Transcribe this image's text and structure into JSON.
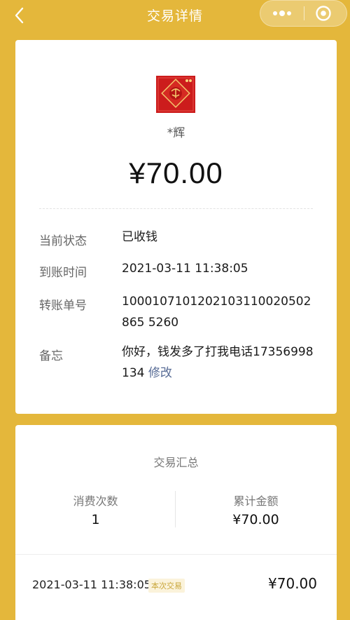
{
  "header": {
    "title": "交易详情"
  },
  "receipt": {
    "payee_name": "*辉",
    "amount": "¥70.00",
    "rows": [
      {
        "label": "当前状态",
        "value": "已收钱"
      },
      {
        "label": "到账时间",
        "value": "2021-03-11 11:38:05"
      },
      {
        "label": "转账单号",
        "value": "1000107101202103110020502865 5260"
      },
      {
        "label": "备忘",
        "value": "你好，钱发多了打我电话17356998134",
        "action": "修改"
      }
    ]
  },
  "summary": {
    "title": "交易汇总",
    "count_label": "消费次数",
    "count_value": "1",
    "total_label": "累计金额",
    "total_value": "¥70.00",
    "transaction": {
      "time": "2021-03-11 11:38:05",
      "badge": "本次交易",
      "amount": "¥70.00"
    }
  },
  "colors": {
    "background": "#e4b73b",
    "card": "#ffffff",
    "link": "#576b95",
    "avatar": "#cc1c1c"
  },
  "icons": {
    "back": "chevron-left-icon",
    "more": "more-dots-icon",
    "close": "circle-dot-icon",
    "avatar": "red-new-year-avatar"
  }
}
